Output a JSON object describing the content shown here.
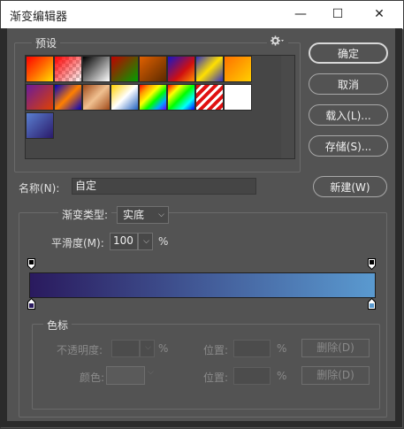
{
  "window": {
    "title": "渐变编辑器",
    "minimize": "—",
    "maximize": "☐",
    "close": "✕"
  },
  "presets": {
    "label": "预设",
    "gear_icon": "gear-icon",
    "swatches": [
      {
        "bg": "linear-gradient(135deg,#ff0000 0%,#ff6a00 50%,#ffe000 100%)"
      },
      {
        "bg": "linear-gradient(135deg,rgba(255,0,0,1) 0%,rgba(255,0,0,0) 100%)",
        "checker": true
      },
      {
        "bg": "linear-gradient(135deg,#000000 0%,#ffffff 100%)"
      },
      {
        "bg": "linear-gradient(135deg,#c00000 0%,#00a000 100%)"
      },
      {
        "bg": "linear-gradient(135deg,#e06000 0%,#5b2a00 100%)"
      },
      {
        "bg": "linear-gradient(135deg,#1515c8 0%,#d01010 60%,#ff9000 100%)"
      },
      {
        "bg": "linear-gradient(135deg,#3030c0 0%,#ffe000 50%,#3030c0 100%)"
      },
      {
        "bg": "linear-gradient(135deg,#ff7000 0%,#ffd000 100%)"
      },
      {
        "bg": "linear-gradient(135deg,#6a1b9a 0%,#e04000 100%)"
      },
      {
        "bg": "linear-gradient(135deg,#0000c0 0%,#ff8000 50%,#0000c0 100%)"
      },
      {
        "bg": "linear-gradient(135deg,#a04a1a 0%,#f0c090 50%,#a04a1a 100%)"
      },
      {
        "bg": "linear-gradient(135deg,#ffd000 0%,#ffffff 50%,#2060c0 100%)"
      },
      {
        "bg": "linear-gradient(135deg,#ff0000,#ff9900,#ffff00,#00ff00,#00aaff,#6600ff)"
      },
      {
        "bg": "linear-gradient(135deg,#ff0000,#ffff00,#00ff00,#00ffff,#0000ff)",
        "checker": true
      },
      {
        "bg": "repeating-linear-gradient(135deg,#e01010 0 4px,#ffffff 4px 7px)"
      },
      {
        "bg": "linear-gradient(135deg,#ffffff 0%,#ffffff 100%)",
        "checker": true
      },
      {
        "bg": "linear-gradient(135deg,#5a7fd0 0%,#2a1a6a 100%)"
      }
    ]
  },
  "buttons": {
    "ok": "确定",
    "cancel": "取消",
    "load": "载入(L)...",
    "save": "存储(S)...",
    "new": "新建(W)"
  },
  "name": {
    "label": "名称(N):",
    "value": "自定"
  },
  "gradient_type": {
    "label": "渐变类型:",
    "value": "实底"
  },
  "smoothness": {
    "label": "平滑度(M):",
    "value": "100",
    "unit": "%"
  },
  "gradient_bar": {
    "start_color": "#2a1a5e",
    "end_color": "#5a9ad0"
  },
  "color_stops": {
    "label": "色标",
    "opacity_label": "不透明度:",
    "opacity_unit": "%",
    "location_label": "位置:",
    "location_unit": "%",
    "delete_label": "删除(D)",
    "color_label": "颜色:",
    "location2_label": "位置:",
    "location2_unit": "%",
    "delete2_label": "删除(D)"
  }
}
